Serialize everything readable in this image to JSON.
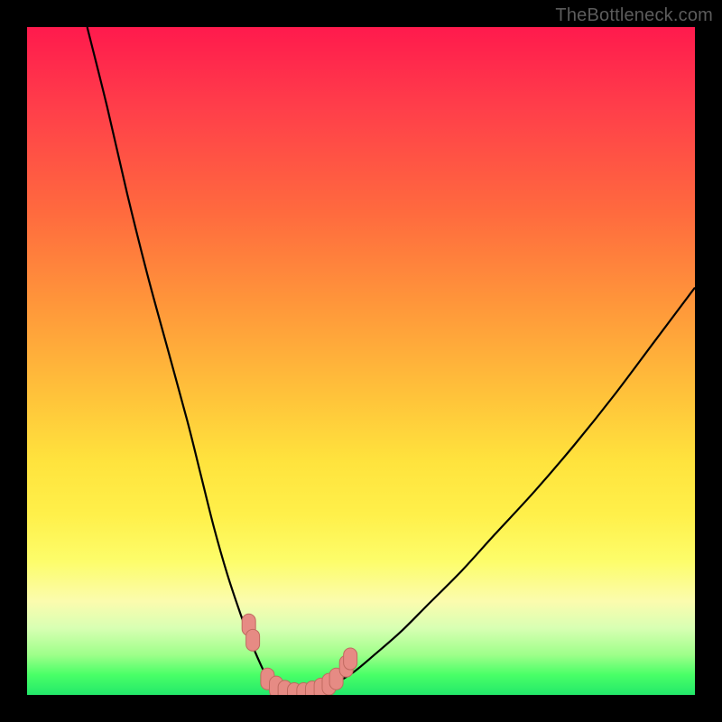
{
  "watermark": "TheBottleneck.com",
  "chart_data": {
    "type": "line",
    "title": "",
    "xlabel": "",
    "ylabel": "",
    "xlim": [
      0,
      100
    ],
    "ylim": [
      0,
      100
    ],
    "gradient_note": "vertical gradient: red (top, high bottleneck) to green (bottom, low bottleneck)",
    "series": [
      {
        "name": "curve-left-arm",
        "x": [
          9,
          12,
          15,
          18,
          21,
          24,
          26,
          28,
          30,
          32,
          33.5,
          35,
          36,
          37
        ],
        "y": [
          100,
          88,
          75,
          63,
          52,
          41,
          33,
          25,
          18,
          12,
          8,
          4.5,
          2.5,
          1.2
        ]
      },
      {
        "name": "curve-valley",
        "x": [
          37,
          38,
          39,
          40,
          41,
          42,
          43,
          44,
          45,
          46
        ],
        "y": [
          1.2,
          0.6,
          0.3,
          0.15,
          0.1,
          0.15,
          0.3,
          0.6,
          1.0,
          1.6
        ]
      },
      {
        "name": "curve-right-arm",
        "x": [
          46,
          49,
          52,
          56,
          60,
          65,
          70,
          76,
          82,
          88,
          94,
          100
        ],
        "y": [
          1.6,
          3.5,
          6,
          9.5,
          13.5,
          18.5,
          24,
          30.5,
          37.5,
          45,
          53,
          61
        ]
      }
    ],
    "markers": [
      {
        "x": 33.2,
        "y": 10.5
      },
      {
        "x": 33.8,
        "y": 8.2
      },
      {
        "x": 36.0,
        "y": 2.4
      },
      {
        "x": 37.3,
        "y": 1.2
      },
      {
        "x": 38.6,
        "y": 0.55
      },
      {
        "x": 40.0,
        "y": 0.2
      },
      {
        "x": 41.4,
        "y": 0.2
      },
      {
        "x": 42.7,
        "y": 0.45
      },
      {
        "x": 44.0,
        "y": 0.9
      },
      {
        "x": 45.2,
        "y": 1.6
      },
      {
        "x": 46.3,
        "y": 2.4
      },
      {
        "x": 47.8,
        "y": 4.3
      },
      {
        "x": 48.4,
        "y": 5.4
      }
    ]
  }
}
